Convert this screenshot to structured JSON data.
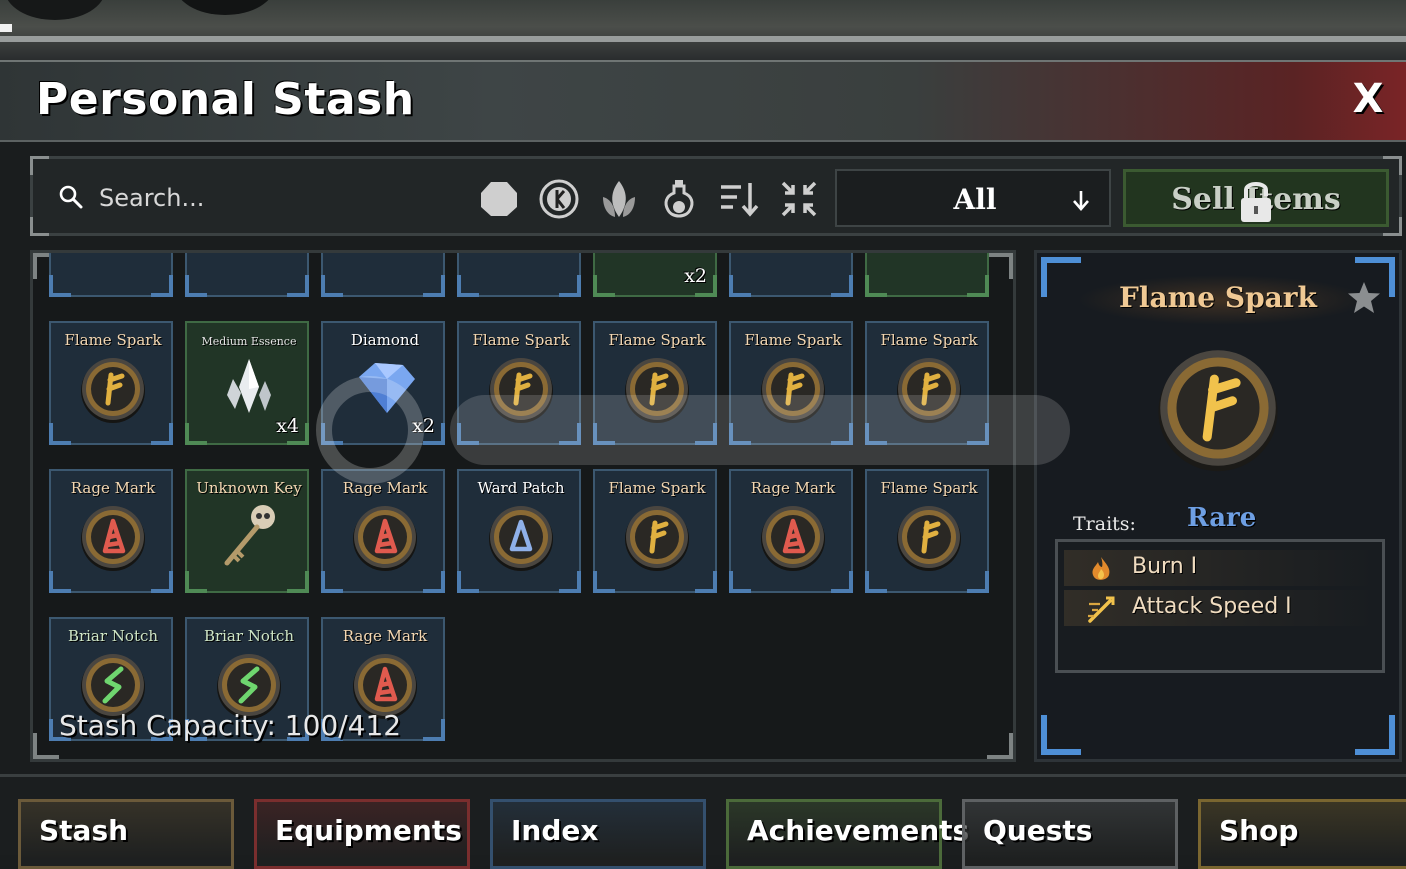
{
  "window": {
    "title": "Personal Stash",
    "close_label": "X"
  },
  "toolbar": {
    "search_placeholder": "Search...",
    "filters": [
      "stone-filter-icon",
      "coin-filter-icon",
      "herb-filter-icon",
      "potion-filter-icon",
      "sort-icon",
      "collapse-icon"
    ],
    "dropdown_value": "All",
    "sell_label": "Sell Items"
  },
  "grid": {
    "top_row_partial": [
      {
        "qty": ""
      },
      {
        "qty": ""
      },
      {
        "qty": ""
      },
      {
        "qty": ""
      },
      {
        "qty": "x2"
      },
      {
        "qty": ""
      },
      {
        "qty": ""
      }
    ],
    "items": [
      {
        "name": "Flame Spark",
        "rune": "flame"
      },
      {
        "name": "Medium Essence",
        "rune": "essence",
        "qty": "x4"
      },
      {
        "name": "Diamond",
        "rune": "diamond",
        "qty": "x2"
      },
      {
        "name": "Flame Spark",
        "rune": "flame"
      },
      {
        "name": "Flame Spark",
        "rune": "flame"
      },
      {
        "name": "Flame Spark",
        "rune": "flame"
      },
      {
        "name": "Flame Spark",
        "rune": "flame"
      },
      {
        "name": "Rage Mark",
        "rune": "rage"
      },
      {
        "name": "Unknown Key",
        "rune": "key"
      },
      {
        "name": "Rage Mark",
        "rune": "rage"
      },
      {
        "name": "Ward Patch",
        "rune": "ward"
      },
      {
        "name": "Flame Spark",
        "rune": "flame"
      },
      {
        "name": "Rage Mark",
        "rune": "rage"
      },
      {
        "name": "Flame Spark",
        "rune": "flame"
      },
      {
        "name": "Briar Notch",
        "rune": "briar"
      },
      {
        "name": "Briar Notch",
        "rune": "briar"
      },
      {
        "name": "Rage Mark",
        "rune": "rage"
      }
    ],
    "capacity_text": "Stash Capacity: 100/412"
  },
  "detail": {
    "name": "Flame Spark",
    "rarity": "Rare",
    "traits_label": "Traits:",
    "traits": [
      {
        "text": "Burn I",
        "icon": "fire-icon"
      },
      {
        "text": "Attack Speed I",
        "icon": "speed-icon"
      }
    ]
  },
  "tabs": [
    {
      "label": "Stash",
      "color": "#6b5a3a"
    },
    {
      "label": "Equipments",
      "color": "#7a2e2e"
    },
    {
      "label": "Index",
      "color": "#34506e"
    },
    {
      "label": "Achievements",
      "color": "#4b6a3a"
    },
    {
      "label": "Quests",
      "color": "#5e6163"
    },
    {
      "label": "Shop",
      "color": "#7a6630"
    }
  ],
  "colors": {
    "rare": "#6e9fe3",
    "flame": "#e0b040",
    "rage": "#e05a4e",
    "ward": "#8fb0e8",
    "briar": "#6fd66f"
  }
}
